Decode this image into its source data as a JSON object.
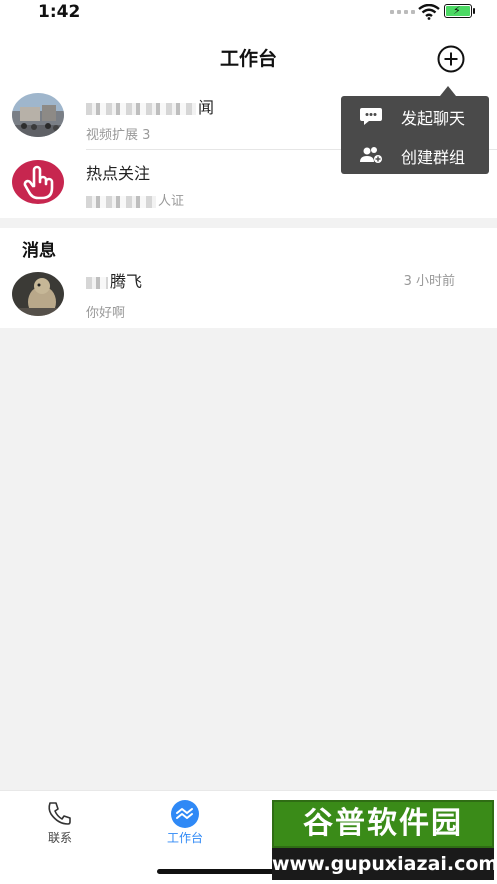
{
  "status_bar": {
    "time": "1:42"
  },
  "header": {
    "title": "工作台"
  },
  "workspace_items": [
    {
      "title_suffix": "闻",
      "subtitle": "视频扩展 3",
      "avatar": "photo-crowd-avatar"
    },
    {
      "title": "热点关注",
      "subtitle_suffix": "人证",
      "avatar": "pink-hand-avatar"
    }
  ],
  "messages": {
    "section_title": "消息",
    "items": [
      {
        "name_suffix": "腾飞",
        "preview": "你好啊",
        "time": "3 小时前",
        "avatar": "marmot-photo-avatar"
      }
    ]
  },
  "popup_menu": {
    "items": [
      {
        "label": "发起聊天",
        "icon": "chat-bubble-icon"
      },
      {
        "label": "创建群组",
        "icon": "group-add-icon"
      }
    ]
  },
  "tabs": [
    {
      "label": "联系",
      "icon": "phone-icon",
      "active": false
    },
    {
      "label": "工作台",
      "icon": "workbench-icon",
      "active": true
    },
    {
      "label": "",
      "icon": "star-square-icon",
      "active": false
    },
    {
      "label": "",
      "icon": "profile-circle-icon",
      "active": false
    }
  ],
  "watermark": {
    "logo_text": "谷普软件园",
    "url": "www.gupuxiazai.com"
  },
  "colors": {
    "accent": "#2f89f6",
    "popup_bg": "#4a4a4a",
    "page_bg": "#f2f2f2"
  }
}
